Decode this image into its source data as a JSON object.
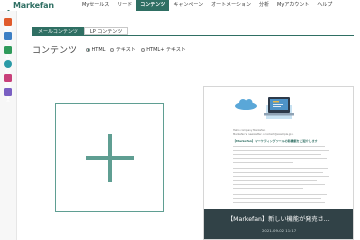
{
  "brand": {
    "name": "Markefan",
    "color": "#2f6f63"
  },
  "nav": {
    "items": [
      "Myセールス",
      "リード",
      "コンテンツ",
      "キャンペーン",
      "オートメーション",
      "分析",
      "Myアカウント",
      "ヘルプ"
    ],
    "active_index": 2
  },
  "sidebar": {
    "icons": [
      {
        "name": "mail-icon",
        "color": "#e05a2b"
      },
      {
        "name": "document-icon",
        "color": "#3d7fc4"
      },
      {
        "name": "form-icon",
        "color": "#2f9a5a"
      },
      {
        "name": "globe-icon",
        "color": "#2a9aa6"
      },
      {
        "name": "image-icon",
        "color": "#c8407a"
      },
      {
        "name": "user-icon",
        "color": "#7a5fc2"
      }
    ]
  },
  "tabs": {
    "mail": "メールコンテンツ",
    "lp": "LP コンテンツ"
  },
  "content": {
    "heading": "コンテンツ",
    "radio_options": [
      "HTML",
      "テキスト",
      "HTML+ テキスト"
    ],
    "selected_option": 0
  },
  "preview": {
    "meta_line1": "Hello company Markefan",
    "meta_line2": "Markefan's newsletter <contact@example.jp>",
    "headline": "【Markefan】マーケティングツールの新機能をご紹介します",
    "overlay_title": "【Markefan】新しい機能が発売さ...",
    "overlay_date": "2021-09-02 11:17"
  }
}
